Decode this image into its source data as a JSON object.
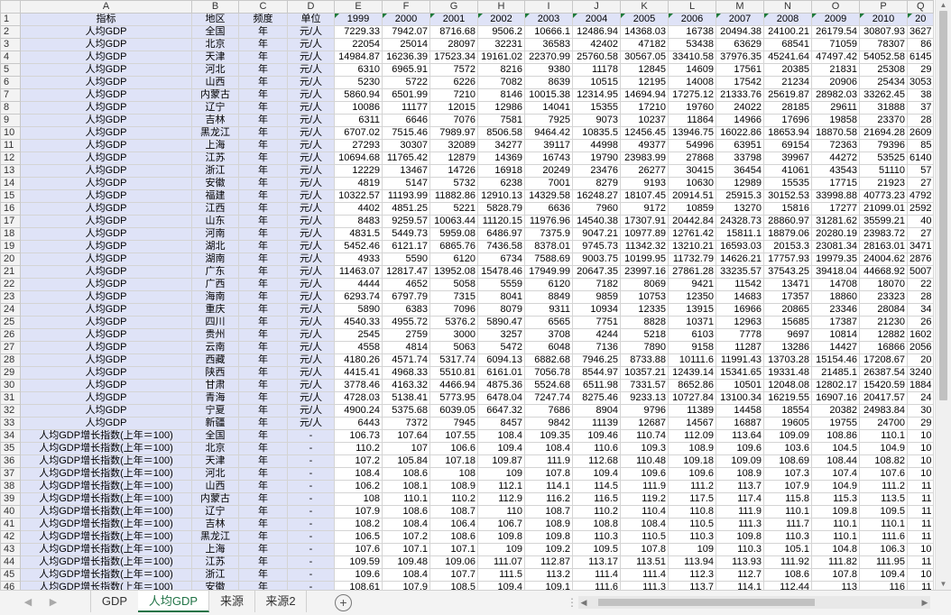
{
  "columns": [
    "A",
    "B",
    "C",
    "D",
    "E",
    "F",
    "G",
    "H",
    "I",
    "J",
    "K",
    "L",
    "M",
    "N",
    "O",
    "P",
    "Q"
  ],
  "headers": [
    "指标",
    "地区",
    "频度",
    "单位",
    "1999",
    "2000",
    "2001",
    "2002",
    "2003",
    "2004",
    "2005",
    "2006",
    "2007",
    "2008",
    "2009",
    "2010",
    "20"
  ],
  "rows": [
    [
      "人均GDP",
      "全国",
      "年",
      "元/人",
      "7229.33",
      "7942.07",
      "8716.68",
      "9506.2",
      "10666.1",
      "12486.94",
      "14368.03",
      "16738",
      "20494.38",
      "24100.21",
      "26179.54",
      "30807.93",
      "3627"
    ],
    [
      "人均GDP",
      "北京",
      "年",
      "元/人",
      "22054",
      "25014",
      "28097",
      "32231",
      "36583",
      "42402",
      "47182",
      "53438",
      "63629",
      "68541",
      "71059",
      "78307",
      "86"
    ],
    [
      "人均GDP",
      "天津",
      "年",
      "元/人",
      "14984.87",
      "16236.39",
      "17523.34",
      "19161.02",
      "22370.99",
      "25760.58",
      "30567.05",
      "33410.58",
      "37976.35",
      "45241.64",
      "47497.42",
      "54052.58",
      "6145"
    ],
    [
      "人均GDP",
      "河北",
      "年",
      "元/人",
      "6310",
      "6965.91",
      "7572",
      "8216",
      "9380",
      "11178",
      "12845",
      "14609",
      "17561",
      "20385",
      "21831",
      "25308",
      "29"
    ],
    [
      "人均GDP",
      "山西",
      "年",
      "元/人",
      "5230",
      "5722",
      "6226",
      "7082",
      "8639",
      "10515",
      "12195",
      "14008",
      "17542",
      "21234",
      "20906",
      "25434",
      "3053"
    ],
    [
      "人均GDP",
      "内蒙古",
      "年",
      "元/人",
      "5860.94",
      "6501.99",
      "7210",
      "8146",
      "10015.38",
      "12314.95",
      "14694.94",
      "17275.12",
      "21333.76",
      "25619.87",
      "28982.03",
      "33262.45",
      "38"
    ],
    [
      "人均GDP",
      "辽宁",
      "年",
      "元/人",
      "10086",
      "11177",
      "12015",
      "12986",
      "14041",
      "15355",
      "17210",
      "19760",
      "24022",
      "28185",
      "29611",
      "31888",
      "37"
    ],
    [
      "人均GDP",
      "吉林",
      "年",
      "元/人",
      "6311",
      "6646",
      "7076",
      "7581",
      "7925",
      "9073",
      "10237",
      "11864",
      "14966",
      "17696",
      "19858",
      "23370",
      "28"
    ],
    [
      "人均GDP",
      "黑龙江",
      "年",
      "元/人",
      "6707.02",
      "7515.46",
      "7989.97",
      "8506.58",
      "9464.42",
      "10835.5",
      "12456.45",
      "13946.75",
      "16022.86",
      "18653.94",
      "18870.58",
      "21694.28",
      "2609"
    ],
    [
      "人均GDP",
      "上海",
      "年",
      "元/人",
      "27293",
      "30307",
      "32089",
      "34277",
      "39117",
      "44998",
      "49377",
      "54996",
      "63951",
      "69154",
      "72363",
      "79396",
      "85"
    ],
    [
      "人均GDP",
      "江苏",
      "年",
      "元/人",
      "10694.68",
      "11765.42",
      "12879",
      "14369",
      "16743",
      "19790",
      "23983.99",
      "27868",
      "33798",
      "39967",
      "44272",
      "53525",
      "6140"
    ],
    [
      "人均GDP",
      "浙江",
      "年",
      "元/人",
      "12229",
      "13467",
      "14726",
      "16918",
      "20249",
      "23476",
      "26277",
      "30415",
      "36454",
      "41061",
      "43543",
      "51110",
      "57"
    ],
    [
      "人均GDP",
      "安徽",
      "年",
      "元/人",
      "4819",
      "5147",
      "5732",
      "6238",
      "7001",
      "8279",
      "9193",
      "10630",
      "12989",
      "15535",
      "17715",
      "21923",
      "27"
    ],
    [
      "人均GDP",
      "福建",
      "年",
      "元/人",
      "10322.57",
      "11193.99",
      "11882.86",
      "12910.13",
      "14329.58",
      "16248.27",
      "18107.45",
      "20914.51",
      "25915.3",
      "30152.53",
      "33998.88",
      "40773.23",
      "4792"
    ],
    [
      "人均GDP",
      "江西",
      "年",
      "元/人",
      "4402",
      "4851.25",
      "5221",
      "5828.79",
      "6636",
      "7960",
      "9172",
      "10859",
      "13270",
      "15816",
      "17277",
      "21099.01",
      "2592"
    ],
    [
      "人均GDP",
      "山东",
      "年",
      "元/人",
      "8483",
      "9259.57",
      "10063.44",
      "11120.15",
      "11976.96",
      "14540.38",
      "17307.91",
      "20442.84",
      "24328.73",
      "28860.97",
      "31281.62",
      "35599.21",
      "40"
    ],
    [
      "人均GDP",
      "河南",
      "年",
      "元/人",
      "4831.5",
      "5449.73",
      "5959.08",
      "6486.97",
      "7375.9",
      "9047.21",
      "10977.89",
      "12761.42",
      "15811.1",
      "18879.06",
      "20280.19",
      "23983.72",
      "27"
    ],
    [
      "人均GDP",
      "湖北",
      "年",
      "元/人",
      "5452.46",
      "6121.17",
      "6865.76",
      "7436.58",
      "8378.01",
      "9745.73",
      "11342.32",
      "13210.21",
      "16593.03",
      "20153.3",
      "23081.34",
      "28163.01",
      "3471"
    ],
    [
      "人均GDP",
      "湖南",
      "年",
      "元/人",
      "4933",
      "5590",
      "6120",
      "6734",
      "7588.69",
      "9003.75",
      "10199.95",
      "11732.79",
      "14626.21",
      "17757.93",
      "19979.35",
      "24004.62",
      "2876"
    ],
    [
      "人均GDP",
      "广东",
      "年",
      "元/人",
      "11463.07",
      "12817.47",
      "13952.08",
      "15478.46",
      "17949.99",
      "20647.35",
      "23997.16",
      "27861.28",
      "33235.57",
      "37543.25",
      "39418.04",
      "44668.92",
      "5007"
    ],
    [
      "人均GDP",
      "广西",
      "年",
      "元/人",
      "4444",
      "4652",
      "5058",
      "5559",
      "6120",
      "7182",
      "8069",
      "9421",
      "11542",
      "13471",
      "14708",
      "18070",
      "22"
    ],
    [
      "人均GDP",
      "海南",
      "年",
      "元/人",
      "6293.74",
      "6797.79",
      "7315",
      "8041",
      "8849",
      "9859",
      "10753",
      "12350",
      "14683",
      "17357",
      "18860",
      "23323",
      "28"
    ],
    [
      "人均GDP",
      "重庆",
      "年",
      "元/人",
      "5890",
      "6383",
      "7096",
      "8079",
      "9311",
      "10934",
      "12335",
      "13915",
      "16966",
      "20865",
      "23346",
      "28084",
      "34"
    ],
    [
      "人均GDP",
      "四川",
      "年",
      "元/人",
      "4540.33",
      "4955.72",
      "5376.2",
      "5890.47",
      "6565",
      "7751",
      "8828",
      "10371",
      "12963",
      "15685",
      "17387",
      "21230",
      "26"
    ],
    [
      "人均GDP",
      "贵州",
      "年",
      "元/人",
      "2545",
      "2759",
      "3000",
      "3257",
      "3708",
      "4244",
      "5218",
      "6103",
      "7778",
      "9697",
      "10814",
      "12882",
      "1602"
    ],
    [
      "人均GDP",
      "云南",
      "年",
      "元/人",
      "4558",
      "4814",
      "5063",
      "5472",
      "6048",
      "7136",
      "7890",
      "9158",
      "11287",
      "13286",
      "14427",
      "16866",
      "2056"
    ],
    [
      "人均GDP",
      "西藏",
      "年",
      "元/人",
      "4180.26",
      "4571.74",
      "5317.74",
      "6094.13",
      "6882.68",
      "7946.25",
      "8733.88",
      "10111.6",
      "11991.43",
      "13703.28",
      "15154.46",
      "17208.67",
      "20"
    ],
    [
      "人均GDP",
      "陕西",
      "年",
      "元/人",
      "4415.41",
      "4968.33",
      "5510.81",
      "6161.01",
      "7056.78",
      "8544.97",
      "10357.21",
      "12439.14",
      "15341.65",
      "19331.48",
      "21485.1",
      "26387.54",
      "3240"
    ],
    [
      "人均GDP",
      "甘肃",
      "年",
      "元/人",
      "3778.46",
      "4163.32",
      "4466.94",
      "4875.36",
      "5524.68",
      "6511.98",
      "7331.57",
      "8652.86",
      "10501",
      "12048.08",
      "12802.17",
      "15420.59",
      "1884"
    ],
    [
      "人均GDP",
      "青海",
      "年",
      "元/人",
      "4728.03",
      "5138.41",
      "5773.95",
      "6478.04",
      "7247.74",
      "8275.46",
      "9233.13",
      "10727.84",
      "13100.34",
      "16219.55",
      "16907.16",
      "20417.57",
      "24"
    ],
    [
      "人均GDP",
      "宁夏",
      "年",
      "元/人",
      "4900.24",
      "5375.68",
      "6039.05",
      "6647.32",
      "7686",
      "8904",
      "9796",
      "11389",
      "14458",
      "18554",
      "20382",
      "24983.84",
      "30"
    ],
    [
      "人均GDP",
      "新疆",
      "年",
      "元/人",
      "6443",
      "7372",
      "7945",
      "8457",
      "9842",
      "11139",
      "12687",
      "14567",
      "16887",
      "19605",
      "19755",
      "24700",
      "29"
    ],
    [
      "人均GDP增长指数(上年＝100)",
      "全国",
      "年",
      "-",
      "106.73",
      "107.64",
      "107.55",
      "108.4",
      "109.35",
      "109.46",
      "110.74",
      "112.09",
      "113.64",
      "109.09",
      "108.86",
      "110.1",
      "10"
    ],
    [
      "人均GDP增长指数(上年＝100)",
      "北京",
      "年",
      "-",
      "110.2",
      "107",
      "106.6",
      "109.4",
      "108.4",
      "110.6",
      "109.3",
      "108.9",
      "109.6",
      "103.6",
      "104.5",
      "104.9",
      "10"
    ],
    [
      "人均GDP增长指数(上年＝100)",
      "天津",
      "年",
      "-",
      "107.2",
      "105.84",
      "107.18",
      "109.87",
      "111.9",
      "112.68",
      "110.48",
      "109.18",
      "109.09",
      "108.69",
      "108.44",
      "108.82",
      "10"
    ],
    [
      "人均GDP增长指数(上年＝100)",
      "河北",
      "年",
      "-",
      "108.4",
      "108.6",
      "108",
      "109",
      "107.8",
      "109.4",
      "109.6",
      "109.6",
      "108.9",
      "107.3",
      "107.4",
      "107.6",
      "10"
    ],
    [
      "人均GDP增长指数(上年＝100)",
      "山西",
      "年",
      "-",
      "106.2",
      "108.1",
      "108.9",
      "112.1",
      "114.1",
      "114.5",
      "111.9",
      "111.2",
      "113.7",
      "107.9",
      "104.9",
      "111.2",
      "11"
    ],
    [
      "人均GDP增长指数(上年＝100)",
      "内蒙古",
      "年",
      "-",
      "108",
      "110.1",
      "110.2",
      "112.9",
      "116.2",
      "116.5",
      "119.2",
      "117.5",
      "117.4",
      "115.8",
      "115.3",
      "113.5",
      "11"
    ],
    [
      "人均GDP增长指数(上年＝100)",
      "辽宁",
      "年",
      "-",
      "107.9",
      "108.6",
      "108.7",
      "110",
      "108.7",
      "110.2",
      "110.4",
      "110.8",
      "111.9",
      "110.1",
      "109.8",
      "109.5",
      "11"
    ],
    [
      "人均GDP增长指数(上年＝100)",
      "吉林",
      "年",
      "-",
      "108.2",
      "108.4",
      "106.4",
      "106.7",
      "108.9",
      "108.8",
      "108.4",
      "110.5",
      "111.3",
      "111.7",
      "110.1",
      "110.1",
      "11"
    ],
    [
      "人均GDP增长指数(上年＝100)",
      "黑龙江",
      "年",
      "-",
      "106.5",
      "107.2",
      "108.6",
      "109.8",
      "109.8",
      "110.3",
      "110.5",
      "110.3",
      "109.8",
      "110.3",
      "110.1",
      "111.6",
      "11"
    ],
    [
      "人均GDP增长指数(上年＝100)",
      "上海",
      "年",
      "-",
      "107.6",
      "107.1",
      "107.1",
      "109",
      "109.2",
      "109.5",
      "107.8",
      "109",
      "110.3",
      "105.1",
      "104.8",
      "106.3",
      "10"
    ],
    [
      "人均GDP增长指数(上年＝100)",
      "江苏",
      "年",
      "-",
      "109.59",
      "109.48",
      "109.06",
      "111.07",
      "112.87",
      "113.17",
      "113.51",
      "113.94",
      "113.93",
      "111.92",
      "111.82",
      "111.95",
      "11"
    ],
    [
      "人均GDP增长指数(上年＝100)",
      "浙江",
      "年",
      "-",
      "109.6",
      "108.4",
      "107.7",
      "111.5",
      "113.2",
      "111.4",
      "111.4",
      "112.3",
      "112.7",
      "108.6",
      "107.8",
      "109.4",
      "10"
    ],
    [
      "人均GDP增长指数(上年＝100)",
      "安徽",
      "年",
      "-",
      "108.61",
      "107.9",
      "108.5",
      "109.4",
      "109.1",
      "111.6",
      "111.3",
      "113.7",
      "114.1",
      "112.44",
      "113",
      "116",
      "11"
    ]
  ],
  "sheet_tabs": [
    "GDP",
    "人均GDP",
    "来源",
    "来源2"
  ],
  "active_tab": "人均GDP",
  "icons": {
    "add_sheet": "plus-circle-icon",
    "more": "ellipsis-icon"
  }
}
